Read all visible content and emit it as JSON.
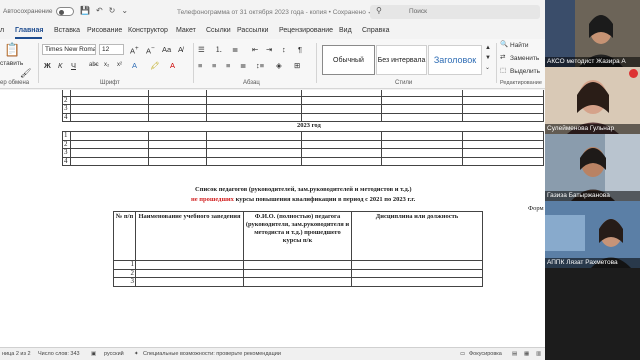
{
  "titlebar": {
    "autosave_label": "Автосохранение",
    "doc_title": "Телефонограмма от 31 октября 2023 года - копия • Сохранено ✓",
    "search_placeholder": "Поиск"
  },
  "tabs": [
    "Главная",
    "Вставка",
    "Рисование",
    "Конструктор",
    "Макет",
    "Ссылки",
    "Рассылки",
    "Рецензирование",
    "Вид",
    "Справка"
  ],
  "active_tab": "Главная",
  "ribbon": {
    "font_name": "Times New Romar",
    "font_size": "12",
    "paste_label": "ставить",
    "group_font": "Шрифт",
    "group_paragraph": "Абзац",
    "group_styles": "Стили",
    "group_editing": "Редактирование",
    "group_clipboard": "ер обмена",
    "styles": [
      "Обычный",
      "Без интервала",
      "Заголовок"
    ],
    "editing": [
      "Найти",
      "Заменить",
      "Выделить"
    ]
  },
  "document": {
    "table1_rows": [
      "2",
      "3",
      "4"
    ],
    "year_heading": "2023 год",
    "table2_rows": [
      "1",
      "2",
      "3",
      "4"
    ],
    "list_title_line1": "Список педагогов (руководителей, зам.руководителей и методистов и т.д.)",
    "list_title_red": "не прошедших",
    "list_title_line2_rest": " курсы повышения квалификации в период с 2021 по 2023 г.г.",
    "form_label": "Форм",
    "table3_headers": [
      "№ п/п",
      "Наименование учебного заведения",
      "Ф.И.О. (полностью) педагога (руководителя, зам.руководителя и методиста и т.д.) прошедшего курсы п/к",
      "Дисциплина или должность"
    ],
    "table3_rows": [
      "1",
      "2",
      "3"
    ]
  },
  "statusbar": {
    "page": "ница 2 из 2",
    "words": "Число слов: 343",
    "lang": "русский",
    "accessibility": "Специальные возможности: проверьте рекомендации",
    "focus": "Фокусировка"
  },
  "participants": [
    {
      "name": "АКСО методист  Жазира А",
      "bg": "#6c6458",
      "skin": "#c69374"
    },
    {
      "name": "Сулейменова Гульнар",
      "bg": "#d9c9b6",
      "skin": "#d5a28a"
    },
    {
      "name": "Газиза Батыржанова",
      "bg": "#8a9cad",
      "skin": "#b98263"
    },
    {
      "name": "АППК Лязат Рахметова",
      "bg": "#5b7fa6",
      "skin": "#c79478"
    }
  ]
}
